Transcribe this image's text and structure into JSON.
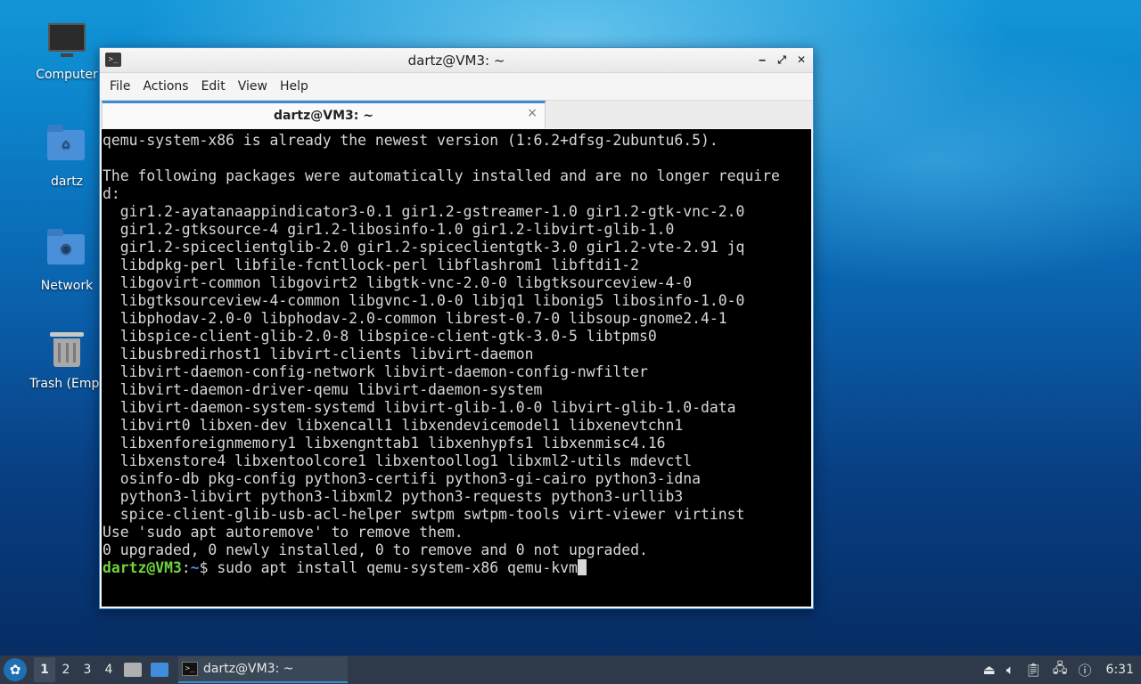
{
  "desktop": {
    "icons": [
      {
        "label": "Computer",
        "icon": "computer-icon"
      },
      {
        "label": "dartz",
        "icon": "home-folder-icon"
      },
      {
        "label": "Network",
        "icon": "network-folder-icon"
      },
      {
        "label": "Trash (Empt",
        "icon": "trash-icon"
      }
    ]
  },
  "window": {
    "title": "dartz@VM3: ~",
    "controls": {
      "minimize": "‒",
      "maximize": "⤢",
      "close": "✕"
    },
    "menu": [
      "File",
      "Actions",
      "Edit",
      "View",
      "Help"
    ],
    "tab": {
      "label": "dartz@VM3: ~",
      "close": "×"
    }
  },
  "terminal": {
    "lines": [
      "qemu-system-x86 is already the newest version (1:6.2+dfsg-2ubuntu6.5).",
      "",
      "The following packages were automatically installed and are no longer require",
      "d:",
      "  gir1.2-ayatanaappindicator3-0.1 gir1.2-gstreamer-1.0 gir1.2-gtk-vnc-2.0",
      "  gir1.2-gtksource-4 gir1.2-libosinfo-1.0 gir1.2-libvirt-glib-1.0",
      "  gir1.2-spiceclientglib-2.0 gir1.2-spiceclientgtk-3.0 gir1.2-vte-2.91 jq",
      "  libdpkg-perl libfile-fcntllock-perl libflashrom1 libftdi1-2",
      "  libgovirt-common libgovirt2 libgtk-vnc-2.0-0 libgtksourceview-4-0",
      "  libgtksourceview-4-common libgvnc-1.0-0 libjq1 libonig5 libosinfo-1.0-0",
      "  libphodav-2.0-0 libphodav-2.0-common librest-0.7-0 libsoup-gnome2.4-1",
      "  libspice-client-glib-2.0-8 libspice-client-gtk-3.0-5 libtpms0",
      "  libusbredirhost1 libvirt-clients libvirt-daemon",
      "  libvirt-daemon-config-network libvirt-daemon-config-nwfilter",
      "  libvirt-daemon-driver-qemu libvirt-daemon-system",
      "  libvirt-daemon-system-systemd libvirt-glib-1.0-0 libvirt-glib-1.0-data",
      "  libvirt0 libxen-dev libxencall1 libxendevicemodel1 libxenevtchn1",
      "  libxenforeignmemory1 libxengnttab1 libxenhypfs1 libxenmisc4.16",
      "  libxenstore4 libxentoolcore1 libxentoollog1 libxml2-utils mdevctl",
      "  osinfo-db pkg-config python3-certifi python3-gi-cairo python3-idna",
      "  python3-libvirt python3-libxml2 python3-requests python3-urllib3",
      "  spice-client-glib-usb-acl-helper swtpm swtpm-tools virt-viewer virtinst",
      "Use 'sudo apt autoremove' to remove them.",
      "0 upgraded, 0 newly installed, 0 to remove and 0 not upgraded."
    ],
    "prompt": {
      "user_host": "dartz@VM3",
      "colon": ":",
      "path": "~",
      "symbol": "$ ",
      "command": "sudo apt install qemu-system-x86 qemu-kvm"
    }
  },
  "taskbar": {
    "workspaces": [
      "1",
      "2",
      "3",
      "4"
    ],
    "task_label": "dartz@VM3: ~",
    "clock": "6:31"
  },
  "colors": {
    "prompt_user": "#6fd43a",
    "prompt_path": "#4a8fe0",
    "accent": "#3b8bd1"
  }
}
